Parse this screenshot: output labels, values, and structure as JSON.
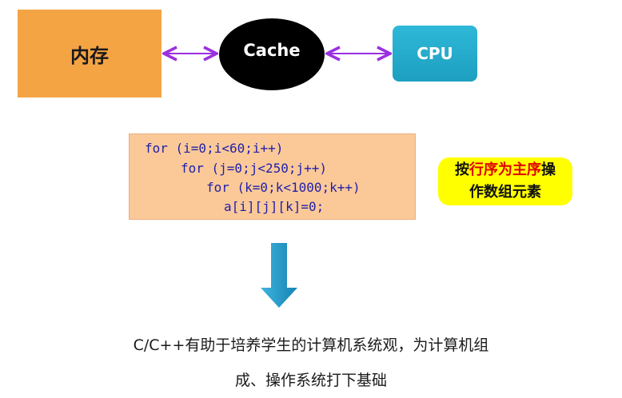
{
  "diagram": {
    "memory": {
      "label": "内存",
      "color": "#f5a444"
    },
    "cache": {
      "label": "Cache",
      "color": "#000000"
    },
    "cpu": {
      "label": "CPU",
      "color": "#1fa8cb"
    },
    "connector_color": "#9b30e0",
    "arrow_color": "#1e90c0"
  },
  "code": {
    "lines": [
      "for (i=0;i<60;i++)",
      "for (j=0;j<250;j++)",
      "for (k=0;k<1000;k++)",
      "a[i][j][k]=0;"
    ],
    "background": "#fbc998",
    "text_color": "#1f1fa8"
  },
  "note": {
    "line1_pre": "按",
    "line1_highlight": "行序为主序",
    "line1_post": "操",
    "line2": "作数组元素",
    "highlight_color": "#e00000",
    "background": "#ffff00"
  },
  "caption": {
    "line1": "C/C++有助于培养学生的计算机系统观，为计算机组",
    "line2": "成、操作系统打下基础"
  }
}
